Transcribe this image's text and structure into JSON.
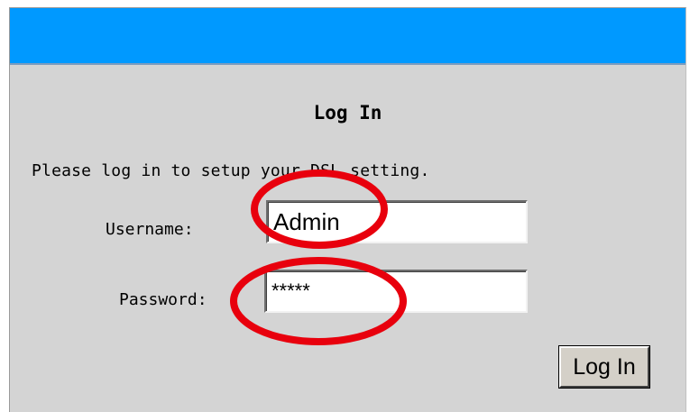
{
  "colors": {
    "title_bar": "#0099ff",
    "panel_background": "#d4d4d4",
    "annotation": "#e8000d"
  },
  "form": {
    "heading": "Log In",
    "instructions": "Please log in to setup your DSL setting.",
    "username_label": "Username:",
    "username_value": "Admin",
    "password_label": "Password:",
    "password_value": "*****",
    "submit_label": "Log In"
  },
  "annotations": {
    "highlighted_fields": [
      "username-field",
      "password-field"
    ]
  }
}
